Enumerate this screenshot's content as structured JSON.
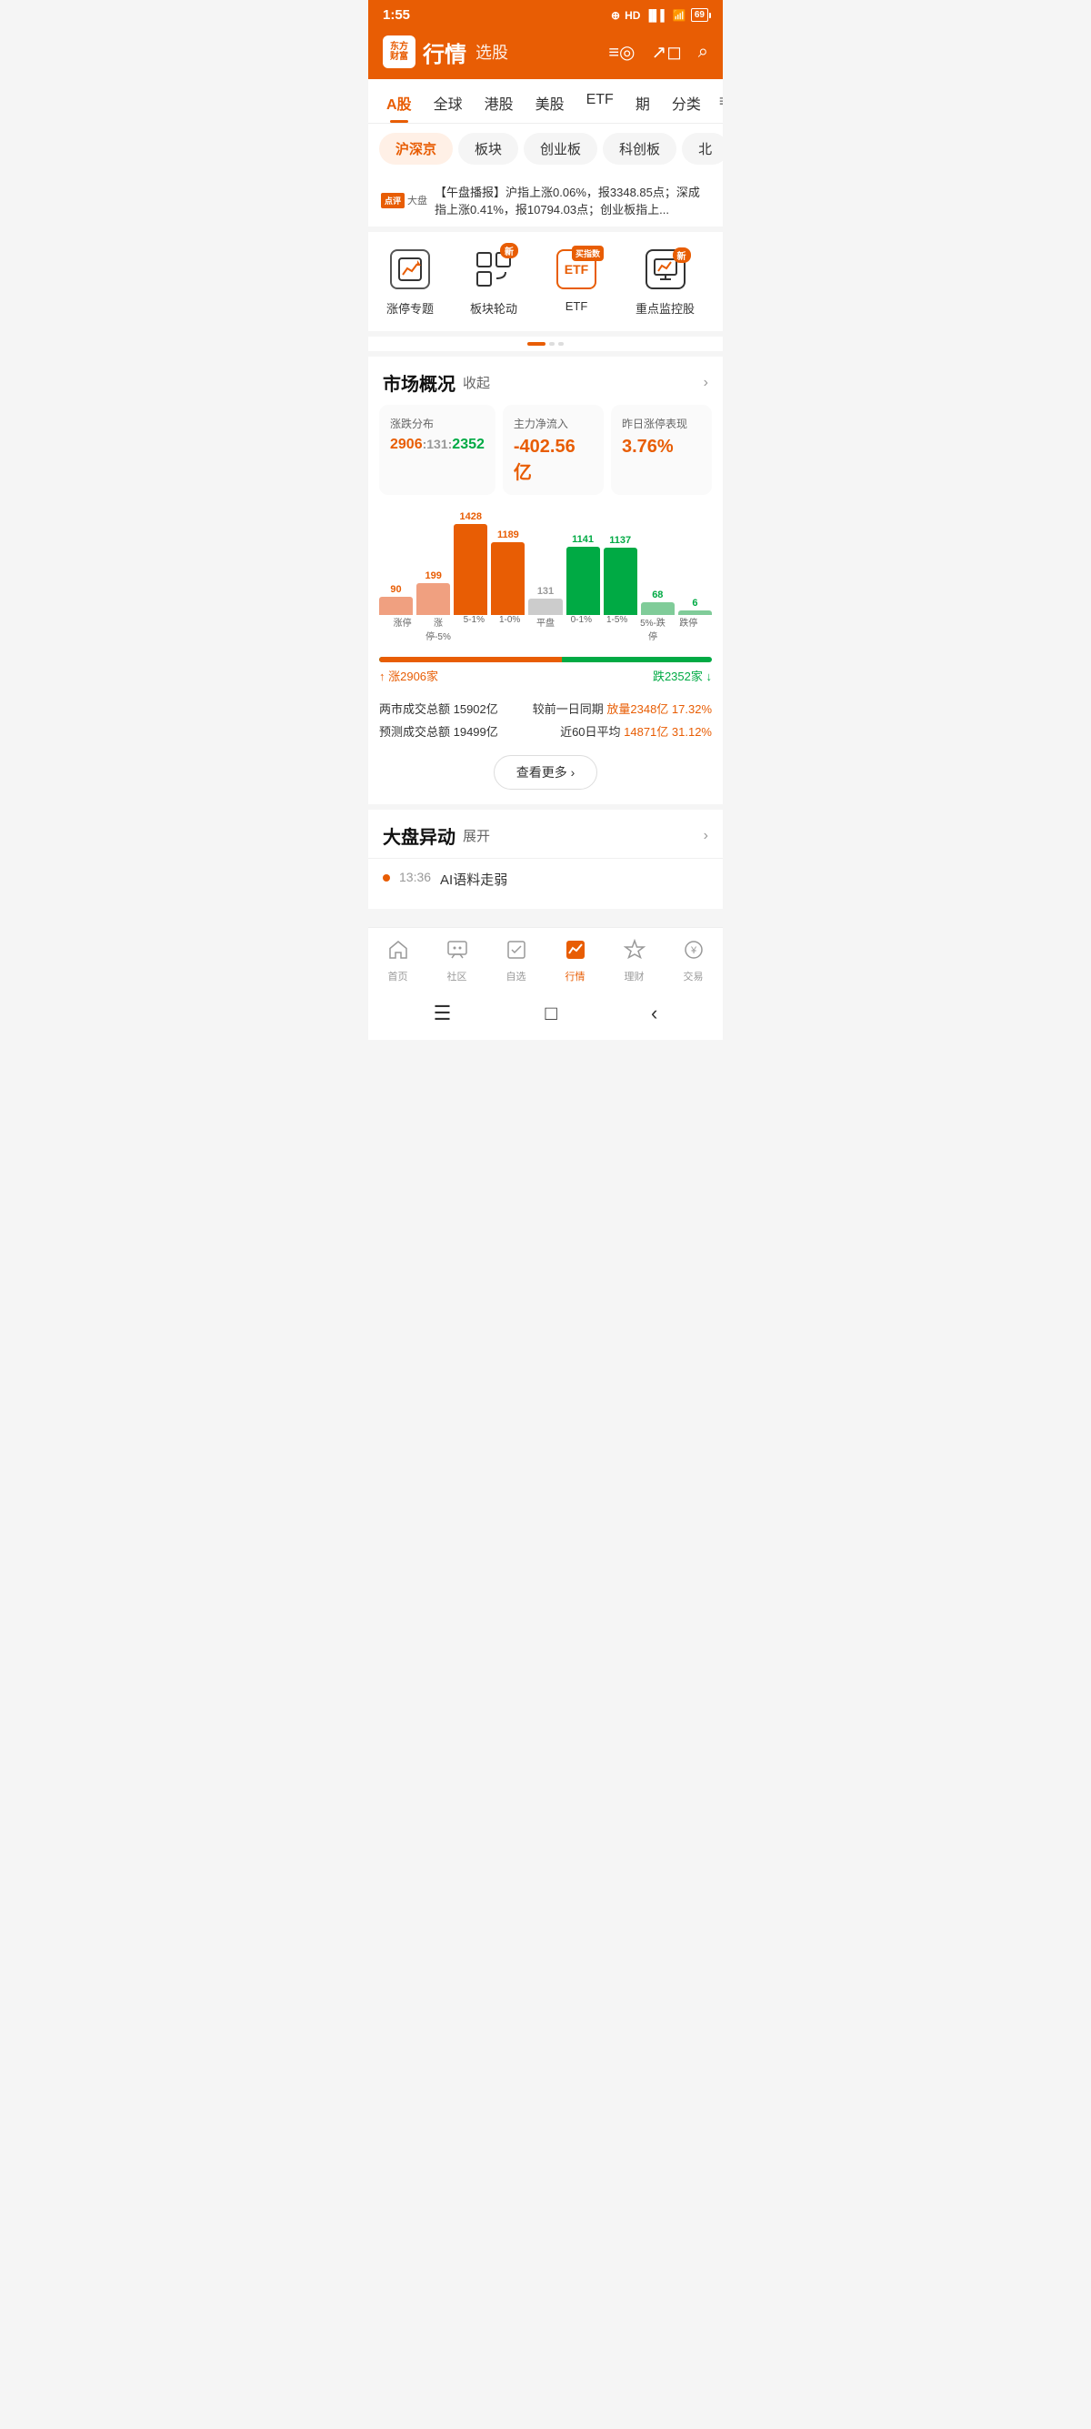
{
  "statusBar": {
    "time": "1:55",
    "battery": "69"
  },
  "header": {
    "logoLine1": "东方",
    "logoLine2": "财富",
    "title": "行情",
    "subtitle": "选股"
  },
  "navTabs": [
    {
      "label": "A股",
      "active": true
    },
    {
      "label": "全球",
      "active": false
    },
    {
      "label": "港股",
      "active": false
    },
    {
      "label": "美股",
      "active": false
    },
    {
      "label": "ETF",
      "active": false
    },
    {
      "label": "期",
      "active": false
    },
    {
      "label": "分类",
      "active": false
    }
  ],
  "subTabs": [
    {
      "label": "沪深京",
      "active": true
    },
    {
      "label": "板块",
      "active": false
    },
    {
      "label": "创业板",
      "active": false
    },
    {
      "label": "科创板",
      "active": false
    },
    {
      "label": "北",
      "active": false
    }
  ],
  "newsBanner": {
    "badgeText": "点评",
    "badgeLabel": "大盘",
    "text": "【午盘播报】沪指上涨0.06%，报3348.85点；深成指上涨0.41%，报10794.03点；创业板指上..."
  },
  "quickAccess": [
    {
      "label": "涨停专题",
      "iconType": "chart-up",
      "badge": null
    },
    {
      "label": "板块轮动",
      "iconType": "cycle",
      "badge": "新"
    },
    {
      "label": "ETF",
      "iconType": "etf",
      "badge": "买指数"
    },
    {
      "label": "重点监控股",
      "iconType": "monitor",
      "badge": "新"
    }
  ],
  "marketOverview": {
    "title": "市场概况",
    "action": "收起",
    "cards": [
      {
        "title": "涨跌分布",
        "rise": "2906",
        "sep1": ":",
        "flat": "131",
        "sep2": ":",
        "fall": "2352"
      },
      {
        "title": "主力净流入",
        "value": "-402.56亿",
        "type": "red"
      },
      {
        "title": "昨日涨停表现",
        "value": "3.76%",
        "type": "red"
      }
    ],
    "bars": [
      {
        "label": "涨停",
        "count": "90",
        "height": 20,
        "type": "light-red"
      },
      {
        "label": "涨停-5%",
        "count": "199",
        "height": 35,
        "type": "light-red"
      },
      {
        "label": "5-1%",
        "count": "1428",
        "height": 100,
        "type": "red"
      },
      {
        "label": "1-0%",
        "count": "1189",
        "height": 80,
        "type": "red"
      },
      {
        "label": "平盘",
        "count": "131",
        "height": 18,
        "type": "gray"
      },
      {
        "label": "0-1%",
        "count": "1141",
        "height": 75,
        "type": "green"
      },
      {
        "label": "1-5%",
        "count": "1137",
        "height": 74,
        "type": "green"
      },
      {
        "label": "5%-跌停",
        "count": "68",
        "height": 14,
        "type": "light-green"
      },
      {
        "label": "跌停",
        "count": "6",
        "height": 5,
        "type": "light-green"
      }
    ],
    "progressRise": 55,
    "riseCount": "涨2906家",
    "fallCount": "跌2352家",
    "stats": [
      {
        "left": "两市成交总额  15902亿",
        "right": "较前一日同期"
      },
      {
        "leftHighlight": "",
        "rightHighlight": "放量2348亿  17.32%"
      },
      {
        "left": "预测成交总额  19499亿",
        "right": "近60日平均"
      },
      {
        "leftHighlight": "",
        "rightHighlight": "14871亿  31.12%"
      }
    ],
    "viewMoreLabel": "查看更多 ›"
  },
  "anomaly": {
    "title": "大盘异动",
    "action": "展开",
    "items": [
      {
        "time": "13:36",
        "text": "AI语料走弱"
      }
    ]
  },
  "bottomNav": [
    {
      "label": "首页",
      "icon": "🏠",
      "active": false
    },
    {
      "label": "社区",
      "icon": "💬",
      "active": false
    },
    {
      "label": "自选",
      "icon": "✓",
      "active": false
    },
    {
      "label": "行情",
      "icon": "📈",
      "active": true
    },
    {
      "label": "理财",
      "icon": "◇",
      "active": false
    },
    {
      "label": "交易",
      "icon": "¥",
      "active": false
    }
  ],
  "systemNav": {
    "menu": "≡",
    "home": "□",
    "back": "‹"
  }
}
